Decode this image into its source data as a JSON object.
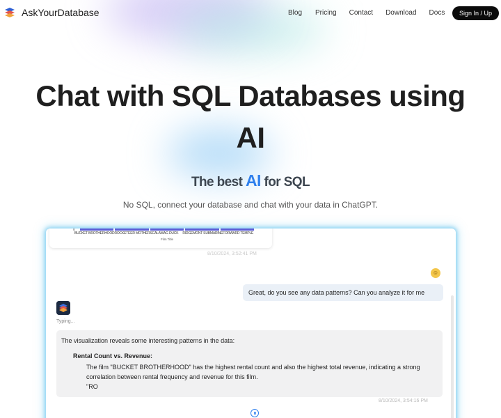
{
  "nav": {
    "brand": "AskYourDatabase",
    "links": [
      "Blog",
      "Pricing",
      "Contact",
      "Download",
      "Docs"
    ],
    "signin_label": "Sign In / Up"
  },
  "hero": {
    "title_line1": "Chat with SQL Databases using",
    "title_line2": "AI",
    "tagline_before": "The best ",
    "tagline_ai": "AI",
    "tagline_after": " for SQL",
    "subtitle": "No SQL, connect your database and chat with your data in ChatGPT."
  },
  "demo": {
    "chart": {
      "zero_tick": "0",
      "categories": [
        "BUCKET BROTHERHOOD",
        "ROCKETEER MOTHER",
        "SCALAWAG DUCK",
        "RIDGEMONT SUBMARINE",
        "FORWARD TEMPLE"
      ],
      "axis_title": "Film Title"
    },
    "timestamp_1": "8/10/2024, 3:52:41 PM",
    "user_message": "Great, do you see any data patterns? Can you analyze it for me",
    "typing_label": "Typing...",
    "bot_intro": "The visualization reveals some interesting patterns in the data:",
    "bot_heading": "Rental Count vs. Revenue:",
    "bot_detail": "The film \"BUCKET BROTHERHOOD\" has the highest rental count and also the highest total revenue, indicating a strong correlation between rental frequency and revenue for this film.",
    "bot_partial": "\"RO",
    "timestamp_2": "8/10/2024, 3:54:16 PM"
  },
  "colors": {
    "accent": "#2f80ed",
    "signin_bg": "#0b0b0b",
    "user_bubble": "#eaf0f7",
    "bot_bubble": "#f1f1f2",
    "demo_glow": "#7dcdf0"
  },
  "icons": {
    "logo": "stacked-database-logo-icon",
    "user_avatar": "smiley-face-icon",
    "bot_avatar": "database-stack-icon",
    "pause": "pause-icon"
  }
}
